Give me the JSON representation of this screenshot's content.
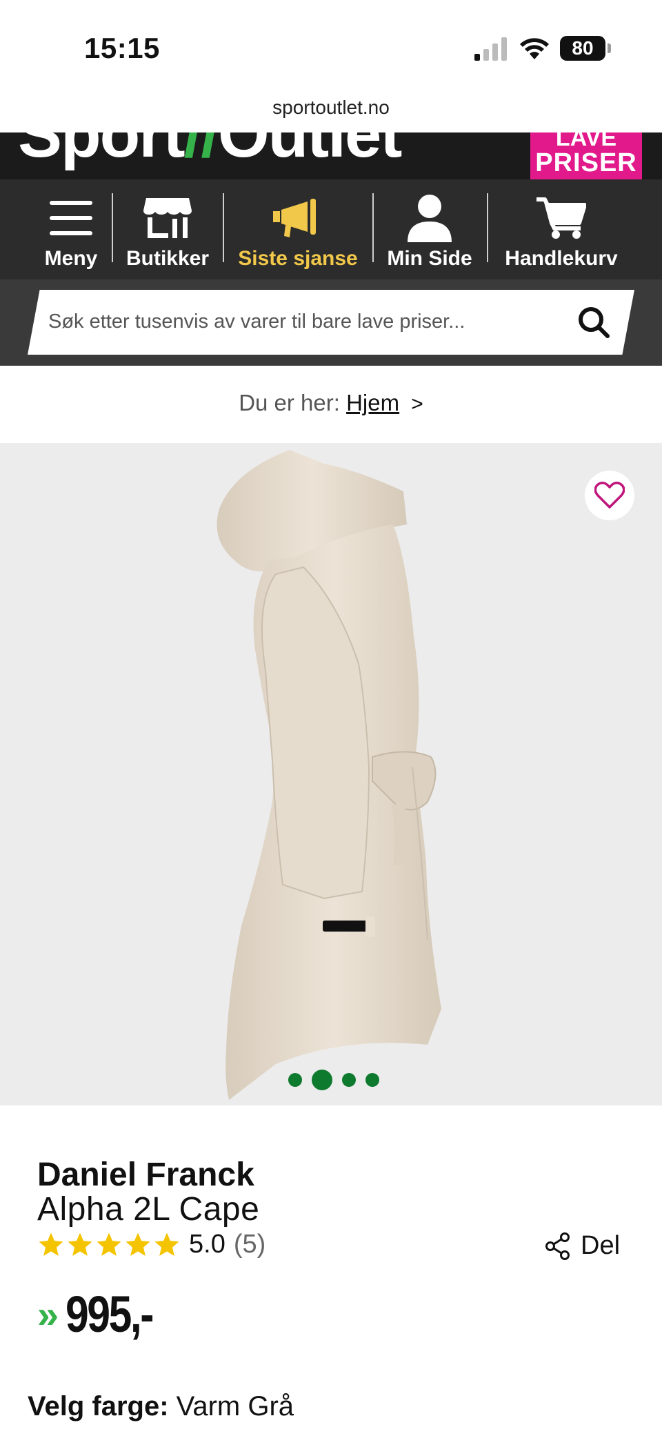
{
  "status_bar": {
    "time": "15:15",
    "battery": "80"
  },
  "browser": {
    "url": "sportoutlet.no"
  },
  "header": {
    "logo_left": "Sport",
    "logo_slash": "//",
    "logo_right": "Outlet",
    "badge_top": "LAVE",
    "badge_bottom": "PRISER"
  },
  "nav": {
    "items": [
      {
        "label": "Meny",
        "icon": "menu-icon"
      },
      {
        "label": "Butikker",
        "icon": "store-icon"
      },
      {
        "label": "Siste sjanse",
        "icon": "megaphone-icon"
      },
      {
        "label": "Min Side",
        "icon": "user-icon"
      },
      {
        "label": "Handlekurv",
        "icon": "cart-icon"
      }
    ],
    "active_color": "#f2c84b"
  },
  "search": {
    "placeholder": "Søk etter tusenvis av varer til bare lave priser..."
  },
  "breadcrumb": {
    "prefix": "Du er her:",
    "home": "Hjem",
    "separator": ">"
  },
  "gallery": {
    "image_count": 4,
    "active_index": 1
  },
  "product": {
    "brand": "Daniel Franck",
    "name": "Alpha 2L Cape",
    "rating": 5.0,
    "rating_text": "5.0",
    "review_count": "(5)",
    "share_label": "Del",
    "price_arrows": "»",
    "price": "995,-",
    "color_label": "Velg farge:",
    "color_value": "Varm Grå"
  },
  "colors": {
    "brand_green": "#35b24a",
    "brand_pink": "#e1198b",
    "dots_green": "#0e7a2e",
    "star_yellow": "#f5c400"
  }
}
